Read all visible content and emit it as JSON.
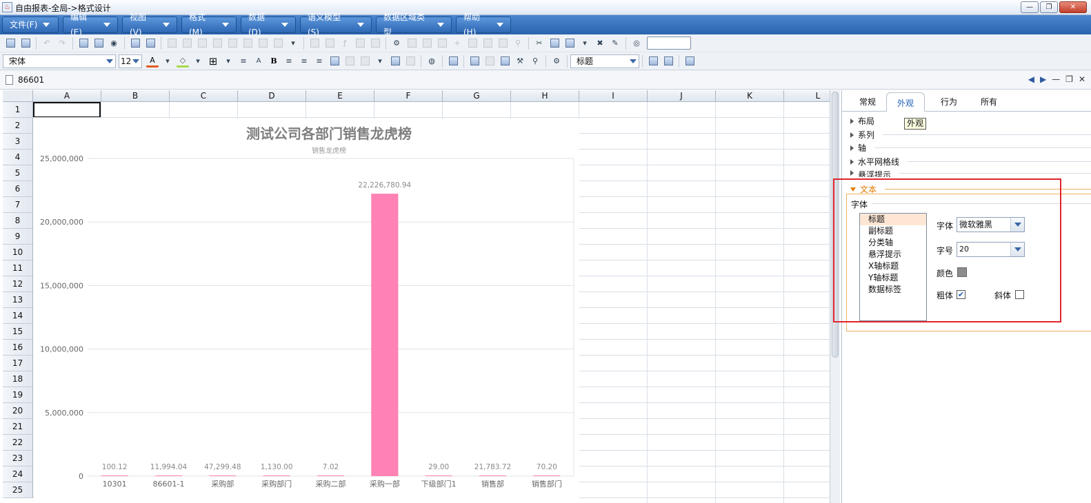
{
  "window": {
    "title": "自由报表-全局->格式设计",
    "app_icon_glyph": "♨",
    "controls": [
      "—",
      "❐",
      "✕"
    ]
  },
  "menu": [
    "文件(F)",
    "编辑(E)",
    "视图(V)",
    "格式(M)",
    "数据(D)",
    "语义模型(S)",
    "数据区域类型",
    "帮助(H)"
  ],
  "format_toolbar": {
    "font_name": "宋体",
    "font_size": "12",
    "style_name": "标题"
  },
  "doc_tab": {
    "name": "86601"
  },
  "sheet": {
    "columns": [
      "A",
      "B",
      "C",
      "D",
      "E",
      "F",
      "G",
      "H",
      "I",
      "J",
      "K",
      "L"
    ],
    "rows": [
      "1",
      "2",
      "3",
      "4",
      "5",
      "6",
      "7",
      "8",
      "9",
      "10",
      "11",
      "12",
      "13",
      "14",
      "15",
      "16",
      "17",
      "18",
      "19",
      "20",
      "21",
      "22",
      "23",
      "24",
      "25"
    ]
  },
  "chart_data": {
    "type": "bar",
    "title": "测试公司各部门销售龙虎榜",
    "subtitle": "销售龙虎榜",
    "categories": [
      "10301",
      "86601-1",
      "采购部",
      "采购部门",
      "采购二部",
      "采购一部",
      "下级部门1",
      "销售部",
      "销售部门"
    ],
    "values": [
      100.12,
      11994.04,
      47299.48,
      1130.0,
      7.02,
      22226780.94,
      29.0,
      21783.72,
      70.2
    ],
    "value_labels": [
      "100.12",
      "11,994.04",
      "47,299.48",
      "1,130.00",
      "7.02",
      "22,226,780.94",
      "29.00",
      "21,783.72",
      "70.20"
    ],
    "ylim": [
      0,
      25000000
    ],
    "y_ticks": [
      0,
      5000000,
      10000000,
      15000000,
      20000000,
      25000000
    ],
    "y_tick_labels": [
      "0",
      "5,000,000",
      "10,000,000",
      "15,000,000",
      "20,000,000",
      "25,000,000"
    ],
    "grid": true,
    "colors": {
      "bar": "#ff82b4",
      "title": "#7f7f7f",
      "axis_text": "#666666",
      "grid": "#e3e3e3"
    }
  },
  "panel": {
    "tabs": [
      "常规",
      "外观",
      "行为",
      "所有"
    ],
    "active_tab": "外观",
    "tooltip": "外观",
    "sections": [
      "布局",
      "系列",
      "轴",
      "水平网格线",
      "悬浮提示"
    ],
    "open_section": "文本",
    "font_group": {
      "label": "字体",
      "items": [
        "标题",
        "副标题",
        "分类轴",
        "悬浮提示",
        "X轴标题",
        "Y轴标题",
        "数据标签"
      ],
      "selected": "标题",
      "font_label": "字体",
      "font_value": "微软雅黑",
      "size_label": "字号",
      "size_value": "20",
      "color_label": "颜色",
      "color_value": "#8c8c8c",
      "bold_label": "粗体",
      "bold_checked": true,
      "italic_label": "斜体",
      "italic_checked": false
    }
  }
}
